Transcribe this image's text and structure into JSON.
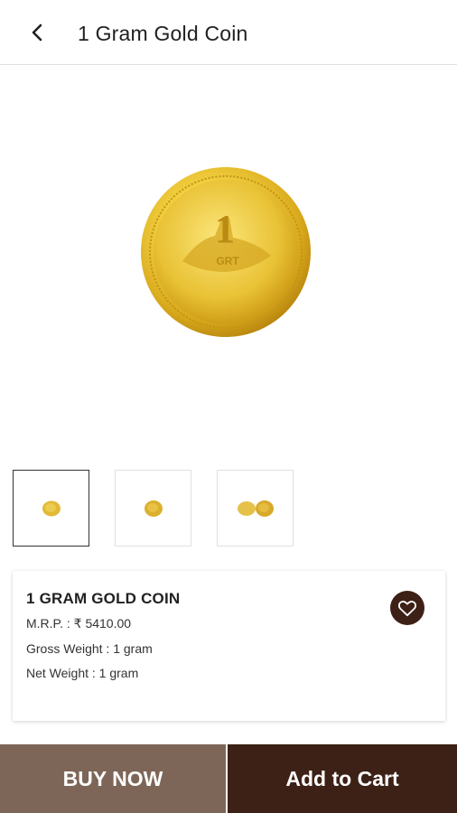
{
  "header": {
    "title": "1 Gram Gold Coin",
    "back_icon": "chevron-left-icon"
  },
  "product": {
    "image_icon": "gold-coin",
    "coin_mark": "1",
    "thumbnails": [
      "gold-coin-thumb-1",
      "gold-coin-thumb-2",
      "gold-coin-thumb-3"
    ],
    "selected_thumbnail": 1,
    "name": "1 GRAM GOLD COIN",
    "mrp": "M.R.P. : ₹ 5410.00",
    "gross_weight": "Gross Weight : 1 gram",
    "net_weight": "Net Weight : 1 gram",
    "wishlist_icon": "heart-icon"
  },
  "actions": {
    "buy_now": "BUY NOW",
    "add_to_cart": "Add to Cart"
  },
  "colors": {
    "buy_now_bg": "#7d6658",
    "add_to_cart_bg": "#3d2117",
    "gold": "#e0b93a"
  }
}
